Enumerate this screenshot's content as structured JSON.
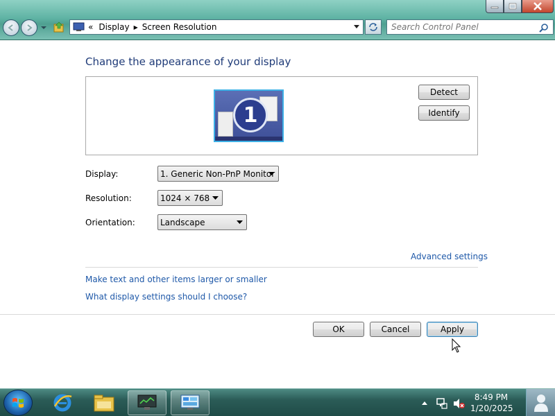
{
  "address_bar": {
    "prefix": "«",
    "crumbs": [
      "Display",
      "Screen Resolution"
    ]
  },
  "search": {
    "placeholder": "Search Control Panel"
  },
  "main": {
    "title": "Change the appearance of your display",
    "detect_label": "Detect",
    "identify_label": "Identify",
    "monitor_number": "1",
    "display_label": "Display:",
    "display_value": "1. Generic Non-PnP Monitor",
    "resolution_label": "Resolution:",
    "resolution_value": "1024 × 768",
    "orientation_label": "Orientation:",
    "orientation_value": "Landscape",
    "advanced_link": "Advanced settings",
    "link_text_size": "Make text and other items larger or smaller",
    "link_help": "What display settings should I choose?",
    "ok_label": "OK",
    "cancel_label": "Cancel",
    "apply_label": "Apply"
  },
  "taskbar": {
    "time": "8:49 PM",
    "date": "1/20/2025",
    "items": [
      "internet-explorer",
      "windows-explorer",
      "screen-resolution-app",
      "control-panel-app"
    ]
  },
  "colors": {
    "title_blue": "#1f3b78",
    "link_blue": "#1e58a8",
    "chrome_teal": "#5fb3a4"
  }
}
